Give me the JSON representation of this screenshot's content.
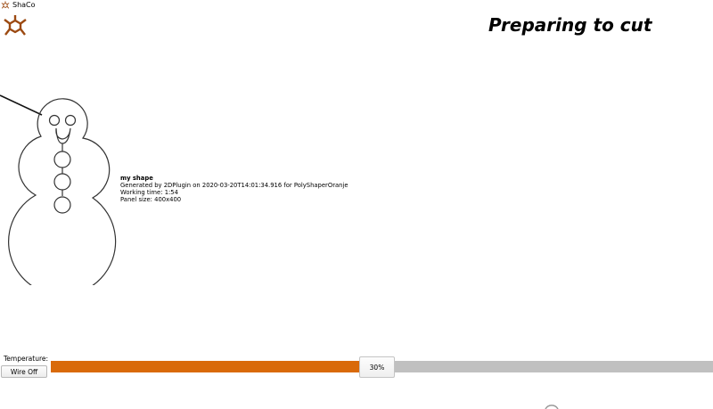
{
  "app": {
    "title": "ShaCo"
  },
  "header": {
    "title": "Preparing to cut"
  },
  "shape": {
    "name": "my shape",
    "generated": "Generated by 2DPlugin on 2020-03-20T14:01:34.916 for PolyShaperOranje",
    "working_time": "Working time: 1:54",
    "panel_size": "Panel size: 400x400"
  },
  "controls": {
    "temperature_label": "Temperature:",
    "wire_button_label": "Wire Off"
  },
  "progress": {
    "value": 0.3,
    "label": "30%"
  },
  "colors": {
    "accent": "#d96a0a",
    "track": "#c0c0c0",
    "logo": "#9c4a12"
  }
}
